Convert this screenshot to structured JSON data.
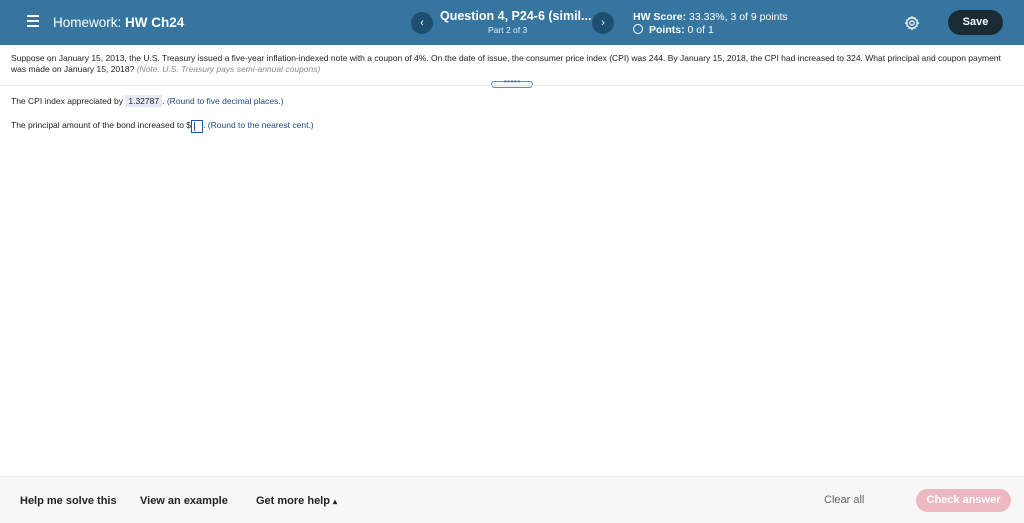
{
  "header": {
    "homework_prefix": "Homework:",
    "homework_name": "HW Ch24",
    "question_title": "Question 4, P24-6 (simil...",
    "question_part": "Part 2 of 3",
    "prev_glyph": "‹",
    "next_glyph": "›",
    "score_label": "HW Score:",
    "score_value": "33.33%, 3 of 9 points",
    "points_label": "Points:",
    "points_value": "0 of 1",
    "save_label": "Save",
    "colors": {
      "bar": "#36759f",
      "save": "#1a2b36"
    }
  },
  "question": {
    "text": "Suppose on January 15, 2013, the U.S. Treasury issued a five-year inflation-indexed note with a coupon of 4%. On the date of issue, the consumer price index (CPI) was 244. By January 15, 2018, the CPI had increased to 324. What principal and coupon payment was made on January 15, 2018?",
    "note": "(Note: U.S. Treasury pays semi-annual coupons)",
    "expand_label": "•••••"
  },
  "parts": {
    "cpi_label": "The CPI index appreciated by",
    "cpi_value": "1.32787",
    "cpi_period": ".",
    "cpi_hint": "(Round to five decimal places.)",
    "principal_label": "The principal amount of the bond increased to $",
    "principal_period": ".",
    "principal_hint": "(Round to the nearest cent.)"
  },
  "footer": {
    "help_label": "Help me solve this",
    "example_label": "View an example",
    "more_help_label": "Get more help",
    "more_help_caret": "▴",
    "clear_label": "Clear all",
    "check_label": "Check answer",
    "colors": {
      "check": "#ecb9c3"
    }
  }
}
